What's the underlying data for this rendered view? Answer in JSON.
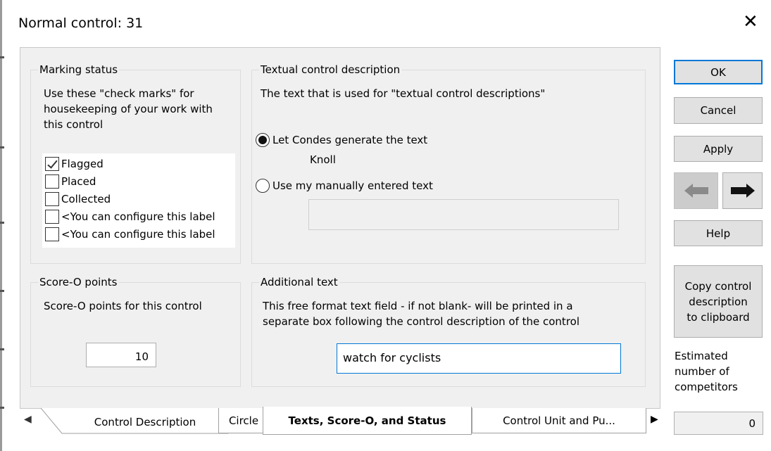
{
  "window": {
    "title": "Normal control: 31",
    "close_glyph": "✕"
  },
  "marking_status": {
    "legend": "Marking status",
    "description": [
      "Use these \"check marks\" for",
      "housekeeping of your work with",
      "this control"
    ],
    "items": [
      {
        "label": "Flagged",
        "checked": true
      },
      {
        "label": "Placed",
        "checked": false
      },
      {
        "label": "Collected",
        "checked": false
      },
      {
        "label": "<You can configure this label",
        "checked": false
      },
      {
        "label": "<You can configure this label",
        "checked": false
      }
    ]
  },
  "textual_description": {
    "legend": "Textual control description",
    "description": "The text that is used for \"textual control descriptions\"",
    "option_generate": "Let Condes generate the text",
    "generated_text": "Knoll",
    "option_manual": "Use my manually entered text",
    "manual_value": "",
    "selected": "generate"
  },
  "score_o": {
    "legend": "Score-O points",
    "description": "Score-O points for this control",
    "value": "10"
  },
  "additional_text": {
    "legend": "Additional text",
    "description": [
      "This free format text field - if not blank- will be printed in a",
      "separate box following the control description of the control"
    ],
    "value": "watch for cyclists"
  },
  "buttons": {
    "ok": "OK",
    "cancel": "Cancel",
    "apply": "Apply",
    "help": "Help",
    "copy": [
      "Copy control",
      "description",
      "to clipboard"
    ]
  },
  "estimated": {
    "label": [
      "Estimated",
      "number of",
      "competitors"
    ],
    "value": "0"
  },
  "tabs": {
    "items": [
      "Control Description",
      "Circle",
      "Texts, Score-O, and Status",
      "Control Unit and Pu..."
    ],
    "active": 2,
    "scroll_left_glyph": "◀",
    "scroll_right_glyph": "▶"
  },
  "colors": {
    "accent": "#0078d7",
    "panel": "#f0f0f0",
    "button": "#e1e1e1"
  }
}
